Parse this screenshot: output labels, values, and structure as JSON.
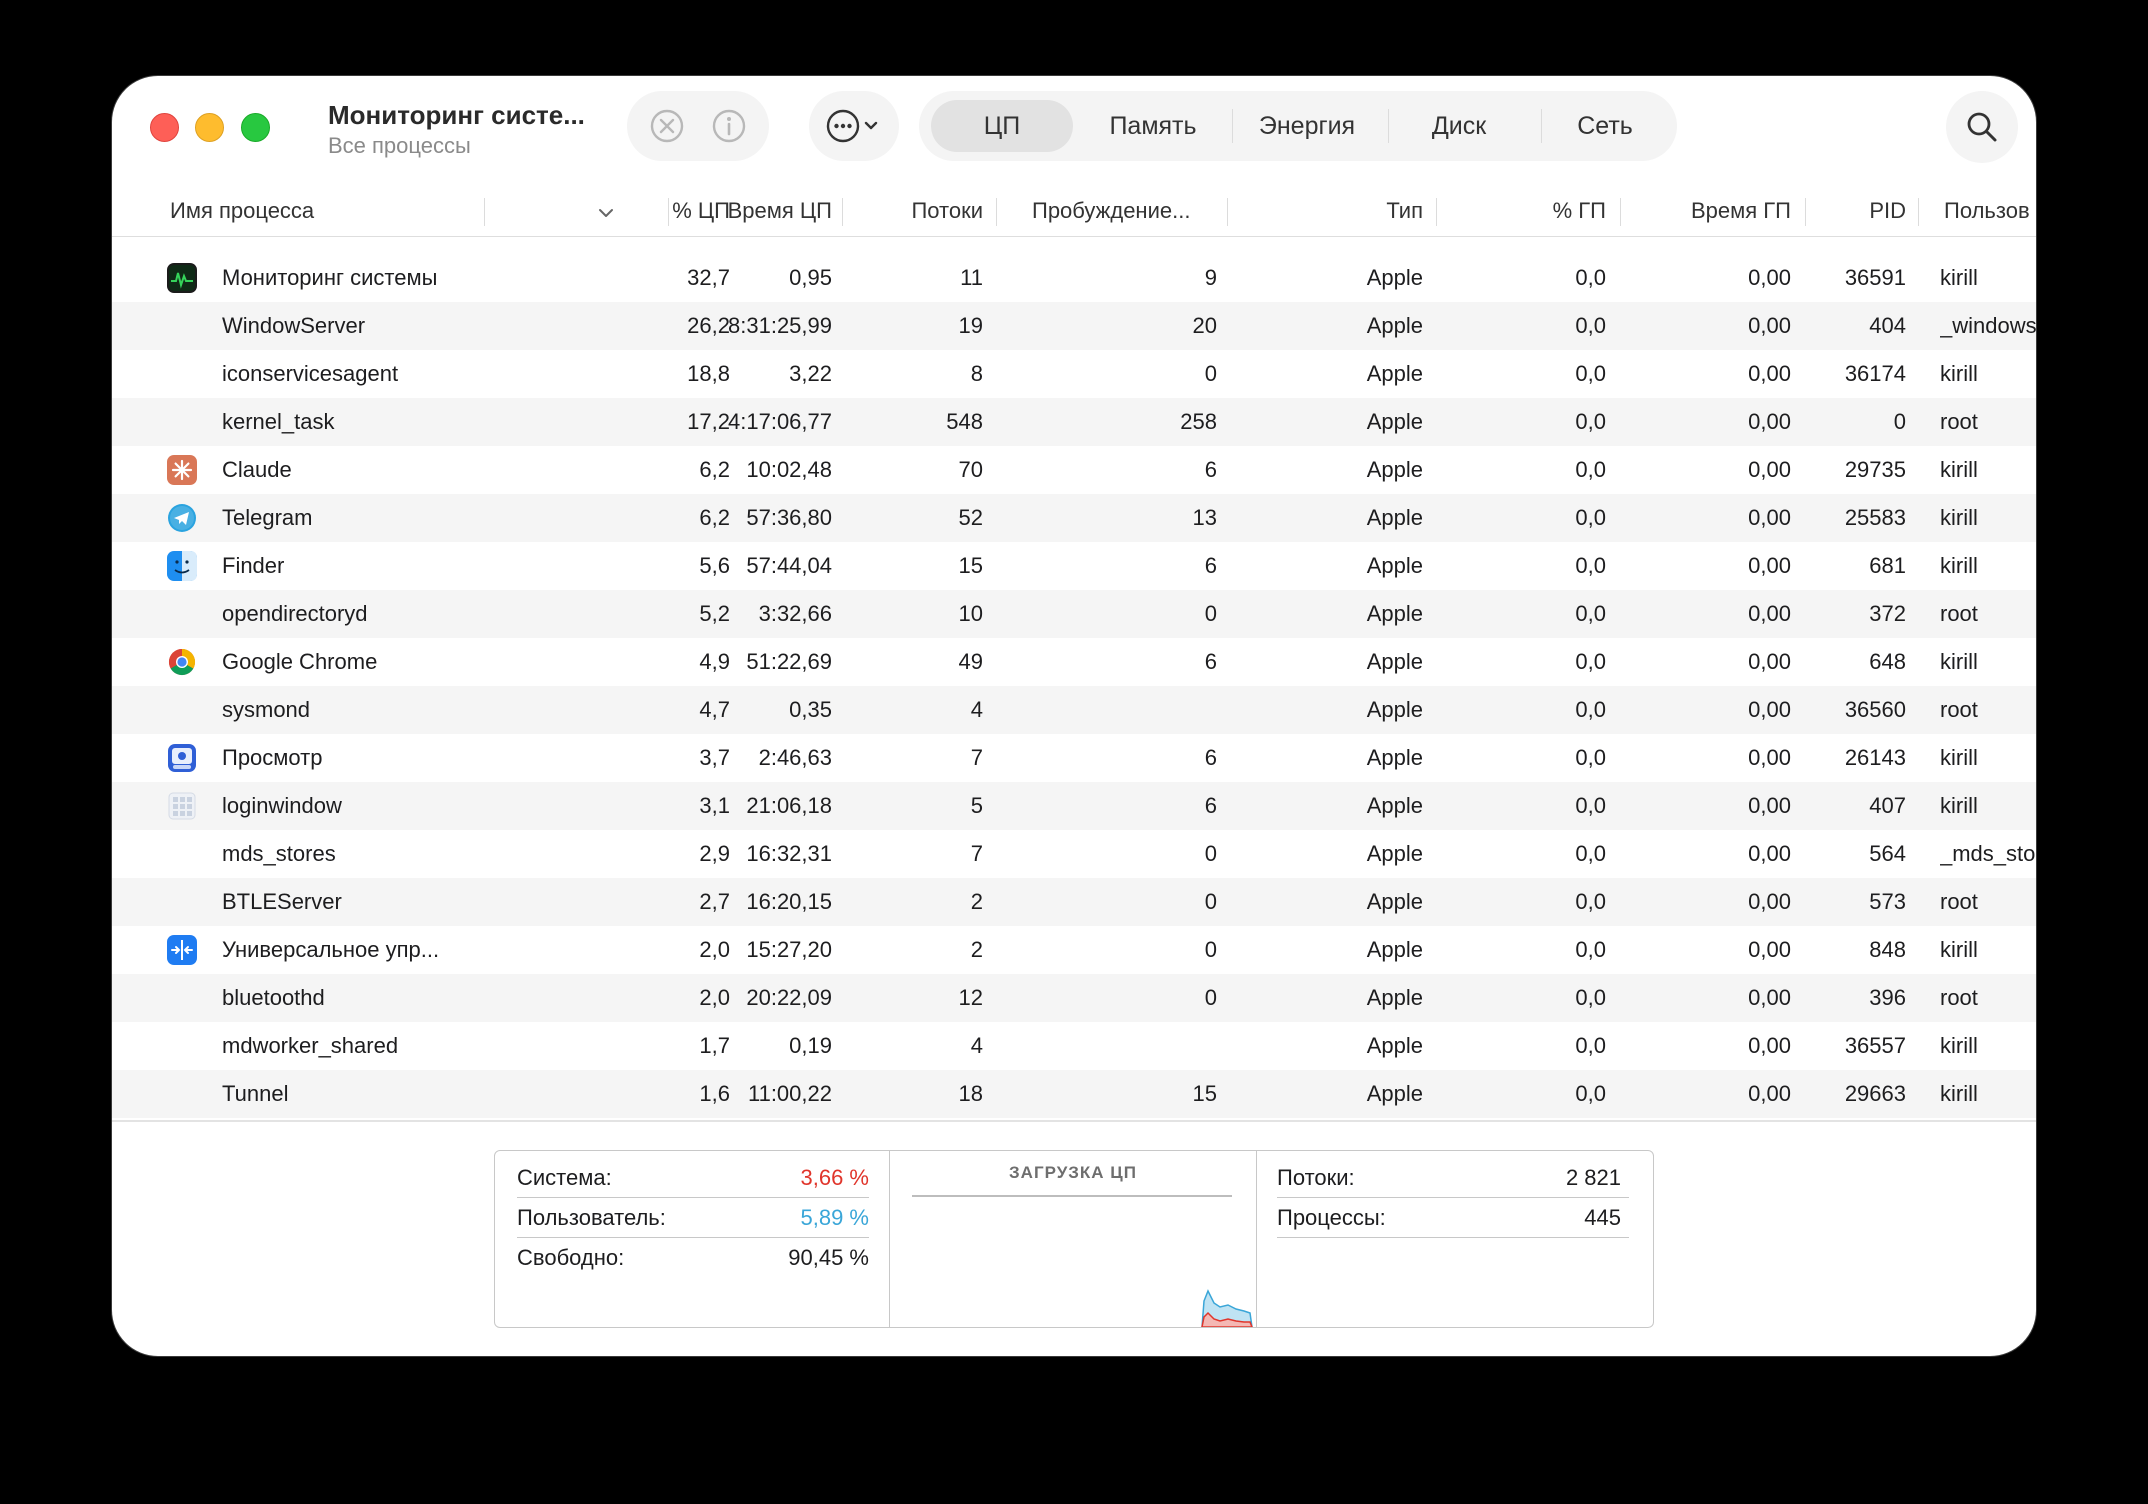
{
  "window": {
    "title": "Мониторинг систе...",
    "subtitle": "Все процессы"
  },
  "tabs": [
    "ЦП",
    "Память",
    "Энергия",
    "Диск",
    "Сеть"
  ],
  "active_tab": "ЦП",
  "icons": {
    "stop": "x-circle-icon",
    "info": "info-icon",
    "more": "ellipsis-icon",
    "search": "search-icon"
  },
  "columns": [
    "Имя процесса",
    "% ЦП",
    "Время ЦП",
    "Потоки",
    "Пробуждение...",
    "Тип",
    "% ГП",
    "Время ГП",
    "PID",
    "Пользов"
  ],
  "rows": [
    {
      "name": "Мониторинг системы",
      "cpu": "32,7",
      "time": "0,95",
      "threads": "11",
      "wakeups": "9",
      "type": "Apple",
      "gpu": "0,0",
      "gputime": "0,00",
      "pid": "36591",
      "user": "kirill",
      "icon": "activity-monitor-icon"
    },
    {
      "name": "WindowServer",
      "cpu": "26,2",
      "time": "8:31:25,99",
      "threads": "19",
      "wakeups": "20",
      "type": "Apple",
      "gpu": "0,0",
      "gputime": "0,00",
      "pid": "404",
      "user": "_windows",
      "icon": ""
    },
    {
      "name": "iconservicesagent",
      "cpu": "18,8",
      "time": "3,22",
      "threads": "8",
      "wakeups": "0",
      "type": "Apple",
      "gpu": "0,0",
      "gputime": "0,00",
      "pid": "36174",
      "user": "kirill",
      "icon": ""
    },
    {
      "name": "kernel_task",
      "cpu": "17,2",
      "time": "4:17:06,77",
      "threads": "548",
      "wakeups": "258",
      "type": "Apple",
      "gpu": "0,0",
      "gputime": "0,00",
      "pid": "0",
      "user": "root",
      "icon": ""
    },
    {
      "name": "Claude",
      "cpu": "6,2",
      "time": "10:02,48",
      "threads": "70",
      "wakeups": "6",
      "type": "Apple",
      "gpu": "0,0",
      "gputime": "0,00",
      "pid": "29735",
      "user": "kirill",
      "icon": "claude-icon"
    },
    {
      "name": "Telegram",
      "cpu": "6,2",
      "time": "57:36,80",
      "threads": "52",
      "wakeups": "13",
      "type": "Apple",
      "gpu": "0,0",
      "gputime": "0,00",
      "pid": "25583",
      "user": "kirill",
      "icon": "telegram-icon"
    },
    {
      "name": "Finder",
      "cpu": "5,6",
      "time": "57:44,04",
      "threads": "15",
      "wakeups": "6",
      "type": "Apple",
      "gpu": "0,0",
      "gputime": "0,00",
      "pid": "681",
      "user": "kirill",
      "icon": "finder-icon"
    },
    {
      "name": "opendirectoryd",
      "cpu": "5,2",
      "time": "3:32,66",
      "threads": "10",
      "wakeups": "0",
      "type": "Apple",
      "gpu": "0,0",
      "gputime": "0,00",
      "pid": "372",
      "user": "root",
      "icon": ""
    },
    {
      "name": "Google Chrome",
      "cpu": "4,9",
      "time": "51:22,69",
      "threads": "49",
      "wakeups": "6",
      "type": "Apple",
      "gpu": "0,0",
      "gputime": "0,00",
      "pid": "648",
      "user": "kirill",
      "icon": "chrome-icon"
    },
    {
      "name": "sysmond",
      "cpu": "4,7",
      "time": "0,35",
      "threads": "4",
      "wakeups": "",
      "type": "Apple",
      "gpu": "0,0",
      "gputime": "0,00",
      "pid": "36560",
      "user": "root",
      "icon": ""
    },
    {
      "name": "Просмотр",
      "cpu": "3,7",
      "time": "2:46,63",
      "threads": "7",
      "wakeups": "6",
      "type": "Apple",
      "gpu": "0,0",
      "gputime": "0,00",
      "pid": "26143",
      "user": "kirill",
      "icon": "preview-icon"
    },
    {
      "name": "loginwindow",
      "cpu": "3,1",
      "time": "21:06,18",
      "threads": "5",
      "wakeups": "6",
      "type": "Apple",
      "gpu": "0,0",
      "gputime": "0,00",
      "pid": "407",
      "user": "kirill",
      "icon": "loginwindow-icon"
    },
    {
      "name": "mds_stores",
      "cpu": "2,9",
      "time": "16:32,31",
      "threads": "7",
      "wakeups": "0",
      "type": "Apple",
      "gpu": "0,0",
      "gputime": "0,00",
      "pid": "564",
      "user": "_mds_sto",
      "icon": ""
    },
    {
      "name": "BTLEServer",
      "cpu": "2,7",
      "time": "16:20,15",
      "threads": "2",
      "wakeups": "0",
      "type": "Apple",
      "gpu": "0,0",
      "gputime": "0,00",
      "pid": "573",
      "user": "root",
      "icon": ""
    },
    {
      "name": "Универсальное упр...",
      "cpu": "2,0",
      "time": "15:27,20",
      "threads": "2",
      "wakeups": "0",
      "type": "Apple",
      "gpu": "0,0",
      "gputime": "0,00",
      "pid": "848",
      "user": "kirill",
      "icon": "universal-control-icon"
    },
    {
      "name": "bluetoothd",
      "cpu": "2,0",
      "time": "20:22,09",
      "threads": "12",
      "wakeups": "0",
      "type": "Apple",
      "gpu": "0,0",
      "gputime": "0,00",
      "pid": "396",
      "user": "root",
      "icon": ""
    },
    {
      "name": "mdworker_shared",
      "cpu": "1,7",
      "time": "0,19",
      "threads": "4",
      "wakeups": "",
      "type": "Apple",
      "gpu": "0,0",
      "gputime": "0,00",
      "pid": "36557",
      "user": "kirill",
      "icon": ""
    },
    {
      "name": "Tunnel",
      "cpu": "1,6",
      "time": "11:00,22",
      "threads": "18",
      "wakeups": "15",
      "type": "Apple",
      "gpu": "0,0",
      "gputime": "0,00",
      "pid": "29663",
      "user": "kirill",
      "icon": ""
    }
  ],
  "summary": {
    "system_label": "Система:",
    "system_value": "3,66 %",
    "user_label": "Пользователь:",
    "user_value": "5,89 %",
    "idle_label": "Свободно:",
    "idle_value": "90,45 %",
    "graph_title": "ЗАГРУЗКА ЦП",
    "threads_label": "Потоки:",
    "threads_value": "2 821",
    "processes_label": "Процессы:",
    "processes_value": "445"
  },
  "colors": {
    "system": "#e0352b",
    "user": "#3aa6d8"
  }
}
